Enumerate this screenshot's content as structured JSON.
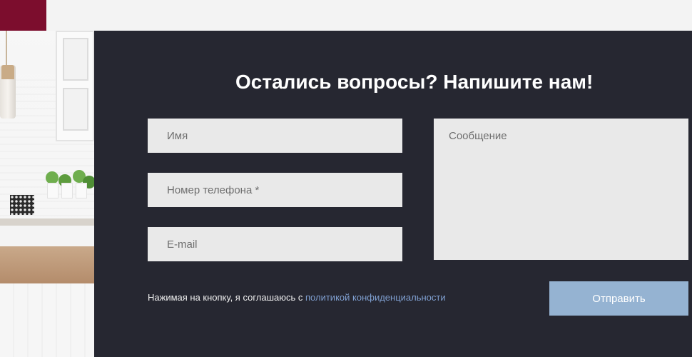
{
  "colors": {
    "brand": "#7c0d2d",
    "panel_bg": "#262731",
    "field_bg": "#e9e9e9",
    "link": "#7f9fd0",
    "submit_bg": "#95b3d2"
  },
  "form": {
    "title": "Остались вопросы? Напишите нам!",
    "name_placeholder": "Имя",
    "phone_placeholder": "Номер телефона *",
    "email_placeholder": "E-mail",
    "message_placeholder": "Сообщение",
    "consent_text": "Нажимая на кнопку, я соглашаюсь с ",
    "consent_link": "политикой конфиденциальности",
    "submit_label": "Отправить"
  }
}
